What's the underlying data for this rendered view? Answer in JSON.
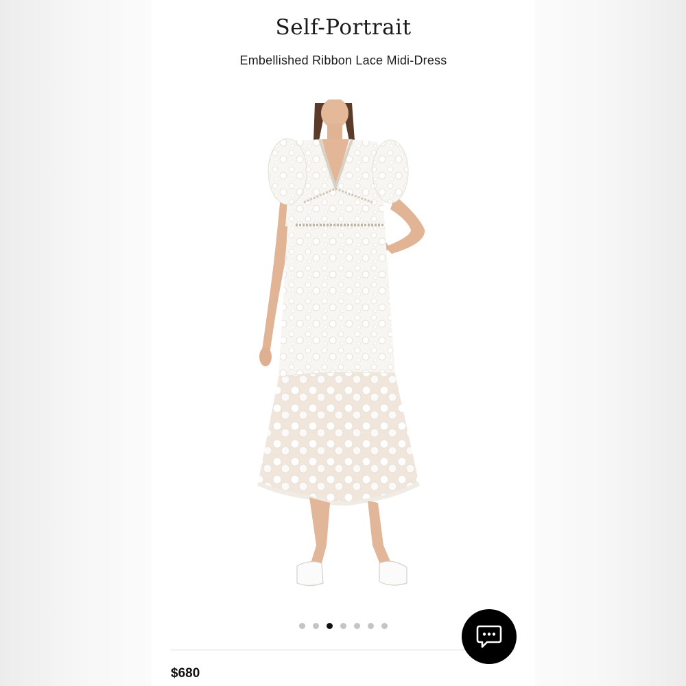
{
  "brand": {
    "name": "Self-Portrait"
  },
  "product": {
    "title": "Embellished Ribbon Lace Midi-Dress",
    "price": "$680",
    "image_alt": "model-wearing-white-lace-midi-dress"
  },
  "gallery": {
    "total_images": 7,
    "active_index": 2
  },
  "chat": {
    "icon": "chat-bubble-icon"
  },
  "colors": {
    "dress": "#f7f5f1",
    "active_dot": "#111111",
    "inactive_dot": "#c4c4c4",
    "chat_button": "#000000"
  }
}
